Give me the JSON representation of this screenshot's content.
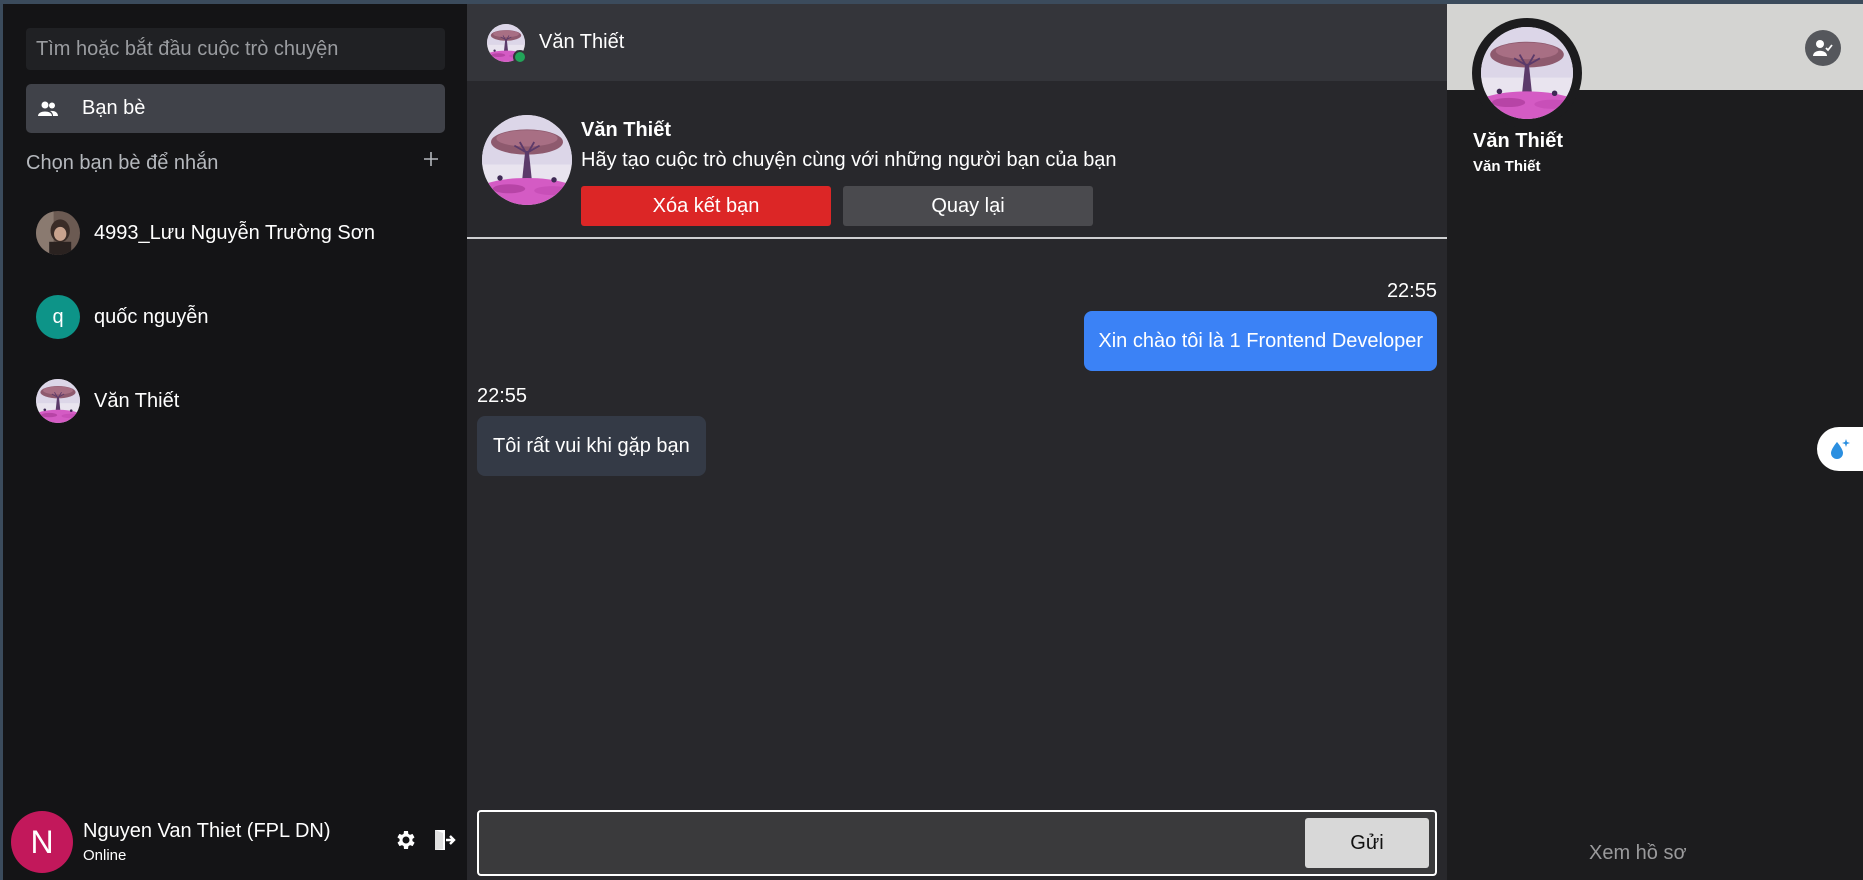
{
  "sidebar": {
    "search_placeholder": "Tìm hoặc bắt đầu cuộc trò chuyện",
    "friends_nav_label": "Bạn bè",
    "section_title": "Chọn bạn bè để nhắn",
    "section_add_icon": "plus-icon",
    "friends": [
      {
        "name": "4993_Lưu Nguyễn Trường Sơn",
        "avatar": "photo"
      },
      {
        "name": "quốc nguyễn",
        "avatar_letter": "q"
      },
      {
        "name": "Văn Thiết",
        "avatar": "tree-illustration"
      }
    ]
  },
  "user": {
    "avatar_letter": "N",
    "name": "Nguyen Van Thiet (FPL DN)",
    "status": "Online",
    "settings_icon": "gear-icon",
    "logout_icon": "logout-icon"
  },
  "chat": {
    "header_name": "Văn Thiết",
    "intro": {
      "name": "Văn Thiết",
      "description": "Hãy tạo cuộc trò chuyện cùng với những người bạn của bạn",
      "unfriend_label": "Xóa kết bạn",
      "back_label": "Quay lại"
    },
    "messages": [
      {
        "direction": "out",
        "time": "22:55",
        "text": "Xin chào tôi là 1 Frontend Developer"
      },
      {
        "direction": "in",
        "time": "22:55",
        "text": "Tôi rất vui khi gặp bạn"
      }
    ],
    "send_label": "Gửi"
  },
  "profile_panel": {
    "name": "Văn Thiết",
    "username": "Văn Thiết",
    "view_profile_label": "Xem hồ sơ",
    "action_icon": "user-check-icon"
  },
  "colors": {
    "accent_blue": "#3b82f6",
    "danger_red": "#dc2626",
    "online_green": "#22a559"
  }
}
